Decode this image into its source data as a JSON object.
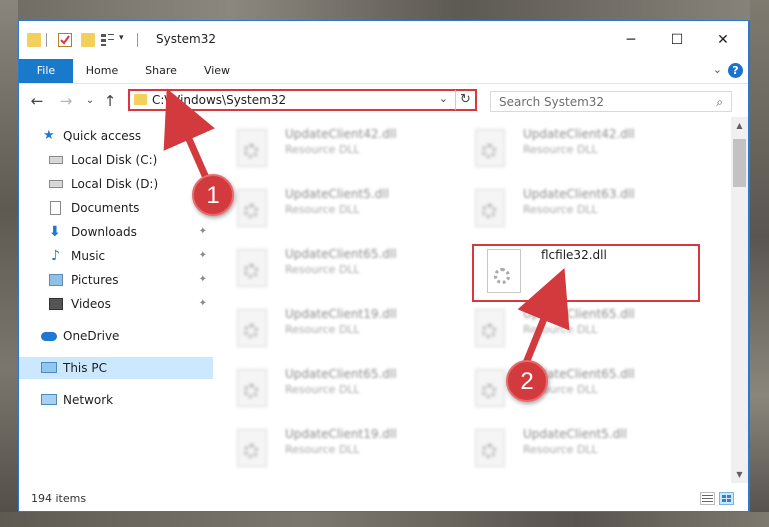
{
  "window": {
    "title": "System32",
    "controls": {
      "minimize": "─",
      "maximize": "☐",
      "close": "✕"
    }
  },
  "ribbon": {
    "tabs": [
      {
        "label": "File",
        "active": true
      },
      {
        "label": "Home"
      },
      {
        "label": "Share"
      },
      {
        "label": "View"
      }
    ],
    "expand": "⌄",
    "help": "?"
  },
  "nav": {
    "back": "←",
    "forward": "→",
    "recent": "⌄",
    "up": "↑",
    "address": "C:\\Windows\\System32",
    "address_chevron": "⌄",
    "refresh": "↻",
    "search_placeholder": "Search System32",
    "search_icon": "⌕"
  },
  "sidebar": {
    "items": [
      {
        "label": "Quick access",
        "icon": "star-icon",
        "color": "#1f78d1"
      },
      {
        "label": "Local Disk (C:)",
        "icon": "drive-icon",
        "pinned": true
      },
      {
        "label": "Local Disk (D:)",
        "icon": "drive-icon"
      },
      {
        "label": "Documents",
        "icon": "documents-icon",
        "pinned": true
      },
      {
        "label": "Downloads",
        "icon": "downloads-icon",
        "pinned": true
      },
      {
        "label": "Music",
        "icon": "music-icon",
        "pinned": true
      },
      {
        "label": "Pictures",
        "icon": "pictures-icon",
        "pinned": true
      },
      {
        "label": "Videos",
        "icon": "videos-icon",
        "pinned": true
      },
      {
        "label": "OneDrive",
        "icon": "onedrive-icon"
      },
      {
        "label": "This PC",
        "icon": "computer-icon",
        "selected": true
      },
      {
        "label": "Network",
        "icon": "network-icon"
      }
    ],
    "pin_glyph": "📌"
  },
  "files": [
    {
      "name": "UpdateClient42.dll",
      "type": "Resource DLL"
    },
    {
      "name": "UpdateClient42.dll",
      "type": "Resource DLL"
    },
    {
      "name": "UpdateClient5.dll",
      "type": "Resource DLL"
    },
    {
      "name": "UpdateClient63.dll",
      "type": "Resource DLL"
    },
    {
      "name": "UpdateClient65.dll",
      "type": "Resource DLL"
    },
    {
      "name": "flcfile32.dll",
      "type": ""
    },
    {
      "name": "UpdateClient19.dll",
      "type": "Resource DLL"
    },
    {
      "name": "UpdateClient65.dll",
      "type": "Resource DLL"
    },
    {
      "name": "UpdateClient65.dll",
      "type": "Resource DLL"
    },
    {
      "name": "UpdateClient65.dll",
      "type": "Resource DLL"
    },
    {
      "name": "UpdateClient19.dll",
      "type": "Resource DLL"
    },
    {
      "name": "UpdateClient5.dll",
      "type": "Resource DLL"
    }
  ],
  "status": {
    "item_count": "194 items"
  },
  "annotations": {
    "step1": "1",
    "step2": "2",
    "color": "#d33a3e"
  }
}
